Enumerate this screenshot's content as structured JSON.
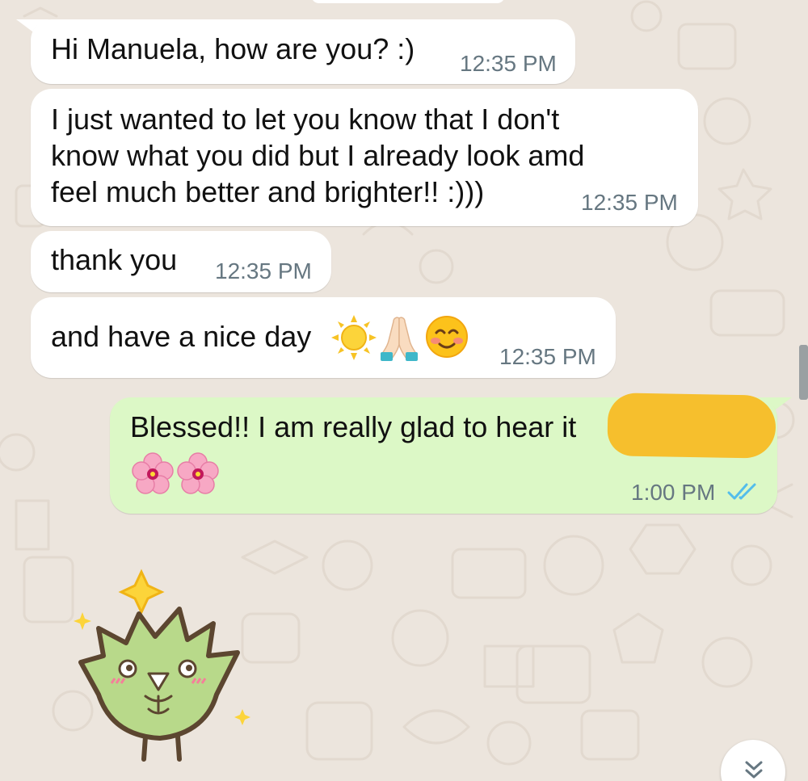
{
  "chat": {
    "messages": [
      {
        "direction": "incoming",
        "text": "Hi Manuela, how are you? :)",
        "time": "12:35 PM"
      },
      {
        "direction": "incoming",
        "lines": [
          "I just wanted to let you know that I don't",
          "know what you did but I already look amd",
          "feel much better and brighter!! :)))"
        ],
        "time": "12:35 PM"
      },
      {
        "direction": "incoming",
        "text": "thank you",
        "time": "12:35 PM"
      },
      {
        "direction": "incoming",
        "text": "and have a nice day",
        "emoji": [
          "sun-emoji",
          "folded-hands-emoji",
          "smiling-blush-emoji"
        ],
        "time": "12:35 PM"
      },
      {
        "direction": "outgoing",
        "text": "Blessed!! I am really glad to hear it",
        "emoji": [
          "cherry-blossom-emoji",
          "cherry-blossom-emoji"
        ],
        "time": "1:00 PM",
        "status": "read",
        "status_icon": "double-check-icon"
      }
    ],
    "sticker": "leaf-character-sticker",
    "scroll_button_icon": "double-chevron-down-icon"
  },
  "colors": {
    "wallpaper": "#ece5dd",
    "incoming_bubble": "#ffffff",
    "outgoing_bubble": "#dcf8c6",
    "timestamp": "#667781",
    "read_ticks": "#53bdeb",
    "redaction": "#f6bf2d"
  }
}
